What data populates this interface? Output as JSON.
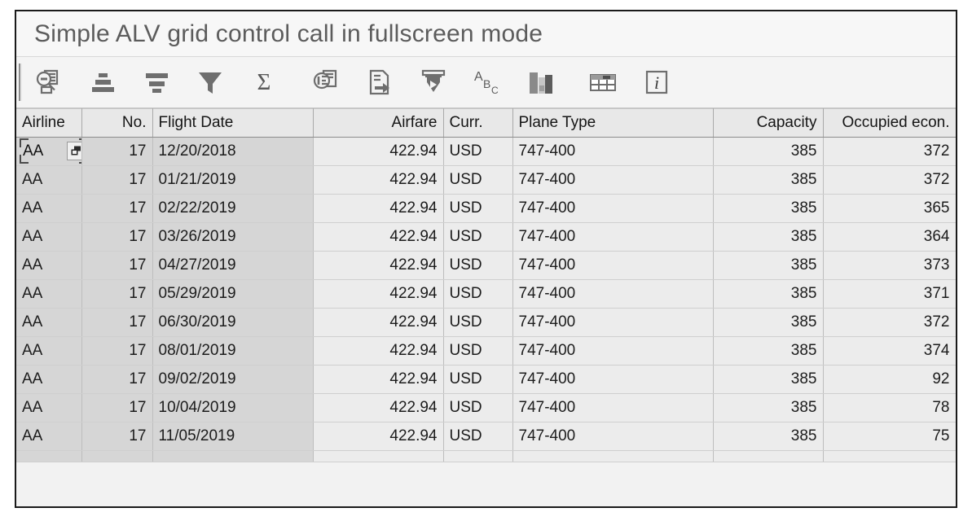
{
  "window": {
    "title": "Simple ALV grid control call in fullscreen mode"
  },
  "toolbar": {
    "grip_name": "toolbar-grip",
    "buttons": [
      {
        "icon": "detail-view-icon",
        "label": "Detail"
      },
      {
        "icon": "sort-ascending-icon",
        "label": "Sort in Ascending Order"
      },
      {
        "icon": "sort-descending-icon",
        "label": "Sort in Descending Order"
      },
      {
        "icon": "filter-icon",
        "label": "Set Filter"
      },
      {
        "icon": "sum-sigma-icon",
        "label": "Total"
      },
      {
        "icon": "subtotal-icon",
        "label": "Subtotals"
      },
      {
        "icon": "export-local-file-icon",
        "label": "Local File"
      },
      {
        "icon": "print-preview-icon",
        "label": "Print Preview"
      },
      {
        "icon": "abc-word-processor-icon",
        "label": "Word Processing"
      },
      {
        "icon": "graphic-chart-icon",
        "label": "Graphic"
      },
      {
        "icon": "layout-grid-icon",
        "label": "Select Layout"
      },
      {
        "icon": "info-icon",
        "label": "Information"
      }
    ]
  },
  "grid": {
    "columns": [
      {
        "key": "airline",
        "label": "Airline",
        "align": "left",
        "band": "key"
      },
      {
        "key": "no",
        "label": "No.",
        "align": "right",
        "band": "key"
      },
      {
        "key": "date",
        "label": "Flight Date",
        "align": "left",
        "band": "key"
      },
      {
        "key": "airfare",
        "label": "Airfare",
        "align": "right",
        "band": "data"
      },
      {
        "key": "curr",
        "label": "Curr.",
        "align": "left",
        "band": "data"
      },
      {
        "key": "plane",
        "label": "Plane Type",
        "align": "left",
        "band": "data"
      },
      {
        "key": "capacity",
        "label": "Capacity",
        "align": "right",
        "band": "data"
      },
      {
        "key": "occupied",
        "label": "Occupied econ.",
        "align": "right",
        "band": "data"
      }
    ],
    "selected_cell": {
      "row": 0,
      "column": "airline",
      "value": "AA",
      "expand_icon": "cell-expand-icon"
    },
    "rows": [
      {
        "airline": "AA",
        "no": "17",
        "date": "12/20/2018",
        "airfare": "422.94",
        "curr": "USD",
        "plane": "747-400",
        "capacity": "385",
        "occupied": "372"
      },
      {
        "airline": "AA",
        "no": "17",
        "date": "01/21/2019",
        "airfare": "422.94",
        "curr": "USD",
        "plane": "747-400",
        "capacity": "385",
        "occupied": "372"
      },
      {
        "airline": "AA",
        "no": "17",
        "date": "02/22/2019",
        "airfare": "422.94",
        "curr": "USD",
        "plane": "747-400",
        "capacity": "385",
        "occupied": "365"
      },
      {
        "airline": "AA",
        "no": "17",
        "date": "03/26/2019",
        "airfare": "422.94",
        "curr": "USD",
        "plane": "747-400",
        "capacity": "385",
        "occupied": "364"
      },
      {
        "airline": "AA",
        "no": "17",
        "date": "04/27/2019",
        "airfare": "422.94",
        "curr": "USD",
        "plane": "747-400",
        "capacity": "385",
        "occupied": "373"
      },
      {
        "airline": "AA",
        "no": "17",
        "date": "05/29/2019",
        "airfare": "422.94",
        "curr": "USD",
        "plane": "747-400",
        "capacity": "385",
        "occupied": "371"
      },
      {
        "airline": "AA",
        "no": "17",
        "date": "06/30/2019",
        "airfare": "422.94",
        "curr": "USD",
        "plane": "747-400",
        "capacity": "385",
        "occupied": "372"
      },
      {
        "airline": "AA",
        "no": "17",
        "date": "08/01/2019",
        "airfare": "422.94",
        "curr": "USD",
        "plane": "747-400",
        "capacity": "385",
        "occupied": "374"
      },
      {
        "airline": "AA",
        "no": "17",
        "date": "09/02/2019",
        "airfare": "422.94",
        "curr": "USD",
        "plane": "747-400",
        "capacity": "385",
        "occupied": "92"
      },
      {
        "airline": "AA",
        "no": "17",
        "date": "10/04/2019",
        "airfare": "422.94",
        "curr": "USD",
        "plane": "747-400",
        "capacity": "385",
        "occupied": "78"
      },
      {
        "airline": "AA",
        "no": "17",
        "date": "11/05/2019",
        "airfare": "422.94",
        "curr": "USD",
        "plane": "747-400",
        "capacity": "385",
        "occupied": "75"
      }
    ],
    "clipped_row_visible": true
  },
  "colors": {
    "window_border": "#1a1a1a",
    "title_text": "#5c5c5c",
    "header_bg": "#e8e8e8",
    "key_column_bg": "#d6d6d6",
    "data_column_bg": "#ececec",
    "icon_gray": "#6e6e6e"
  }
}
